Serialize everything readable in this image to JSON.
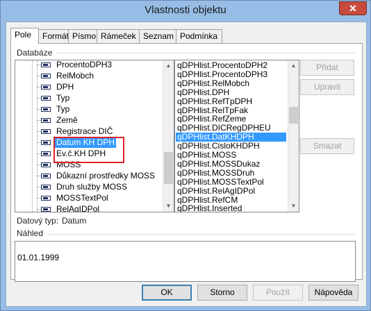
{
  "window": {
    "title": "Vlastnosti objektu",
    "close_symbol": "✕"
  },
  "tabs": [
    {
      "label": "Pole",
      "active": true
    },
    {
      "label": "Formát"
    },
    {
      "label": "Písmo"
    },
    {
      "label": "Rámeček"
    },
    {
      "label": "Seznam"
    },
    {
      "label": "Podmínka"
    }
  ],
  "database": {
    "label": "Databáze",
    "tree_items": [
      "ProcentoDPH3",
      "RelMobch",
      "DPH",
      "Typ",
      "Typ",
      "Země",
      "Registrace DIČ",
      "Datum KH DPH",
      "Ev.č.KH DPH",
      "MOSS",
      "Důkazní prostředky MOSS",
      "Druh služby MOSS",
      "MOSSTextPol",
      "RelAgIDPol"
    ],
    "tree_selected": "Datum KH DPH",
    "fields_list": [
      "qDPHlist.ProcentoDPH2",
      "qDPHlist.ProcentoDPH3",
      "qDPHlist.RelMobch",
      "qDPHlist.DPH",
      "qDPHlist.RefTpDPH",
      "qDPHlist.RelTpFak",
      "qDPHlist.RefZeme",
      "qDPHlist.DICRegDPHEU",
      "qDPHlist.DatKHDPH",
      "qDPHlist.CisloKHDPH",
      "qDPHlist.MOSS",
      "qDPHlist.MOSSDukaz",
      "qDPHlist.MOSSDruh",
      "qDPHlist.MOSSTextPol",
      "qDPHlist.RelAgIDPol",
      "qDPHlist.RefCM",
      "qDPHlist.Inserted"
    ],
    "fields_selected": "qDPHlist.DatKHDPH"
  },
  "side_buttons": {
    "add": "Přidat",
    "edit": "Upravit",
    "delete": "Smazat"
  },
  "datatype": {
    "label": "Datový typ:",
    "value": "Datum"
  },
  "preview": {
    "label": "Náhled",
    "value": "01.01.1999"
  },
  "footer": {
    "ok": "OK",
    "cancel": "Storno",
    "apply": "Použít",
    "help": "Nápověda"
  }
}
